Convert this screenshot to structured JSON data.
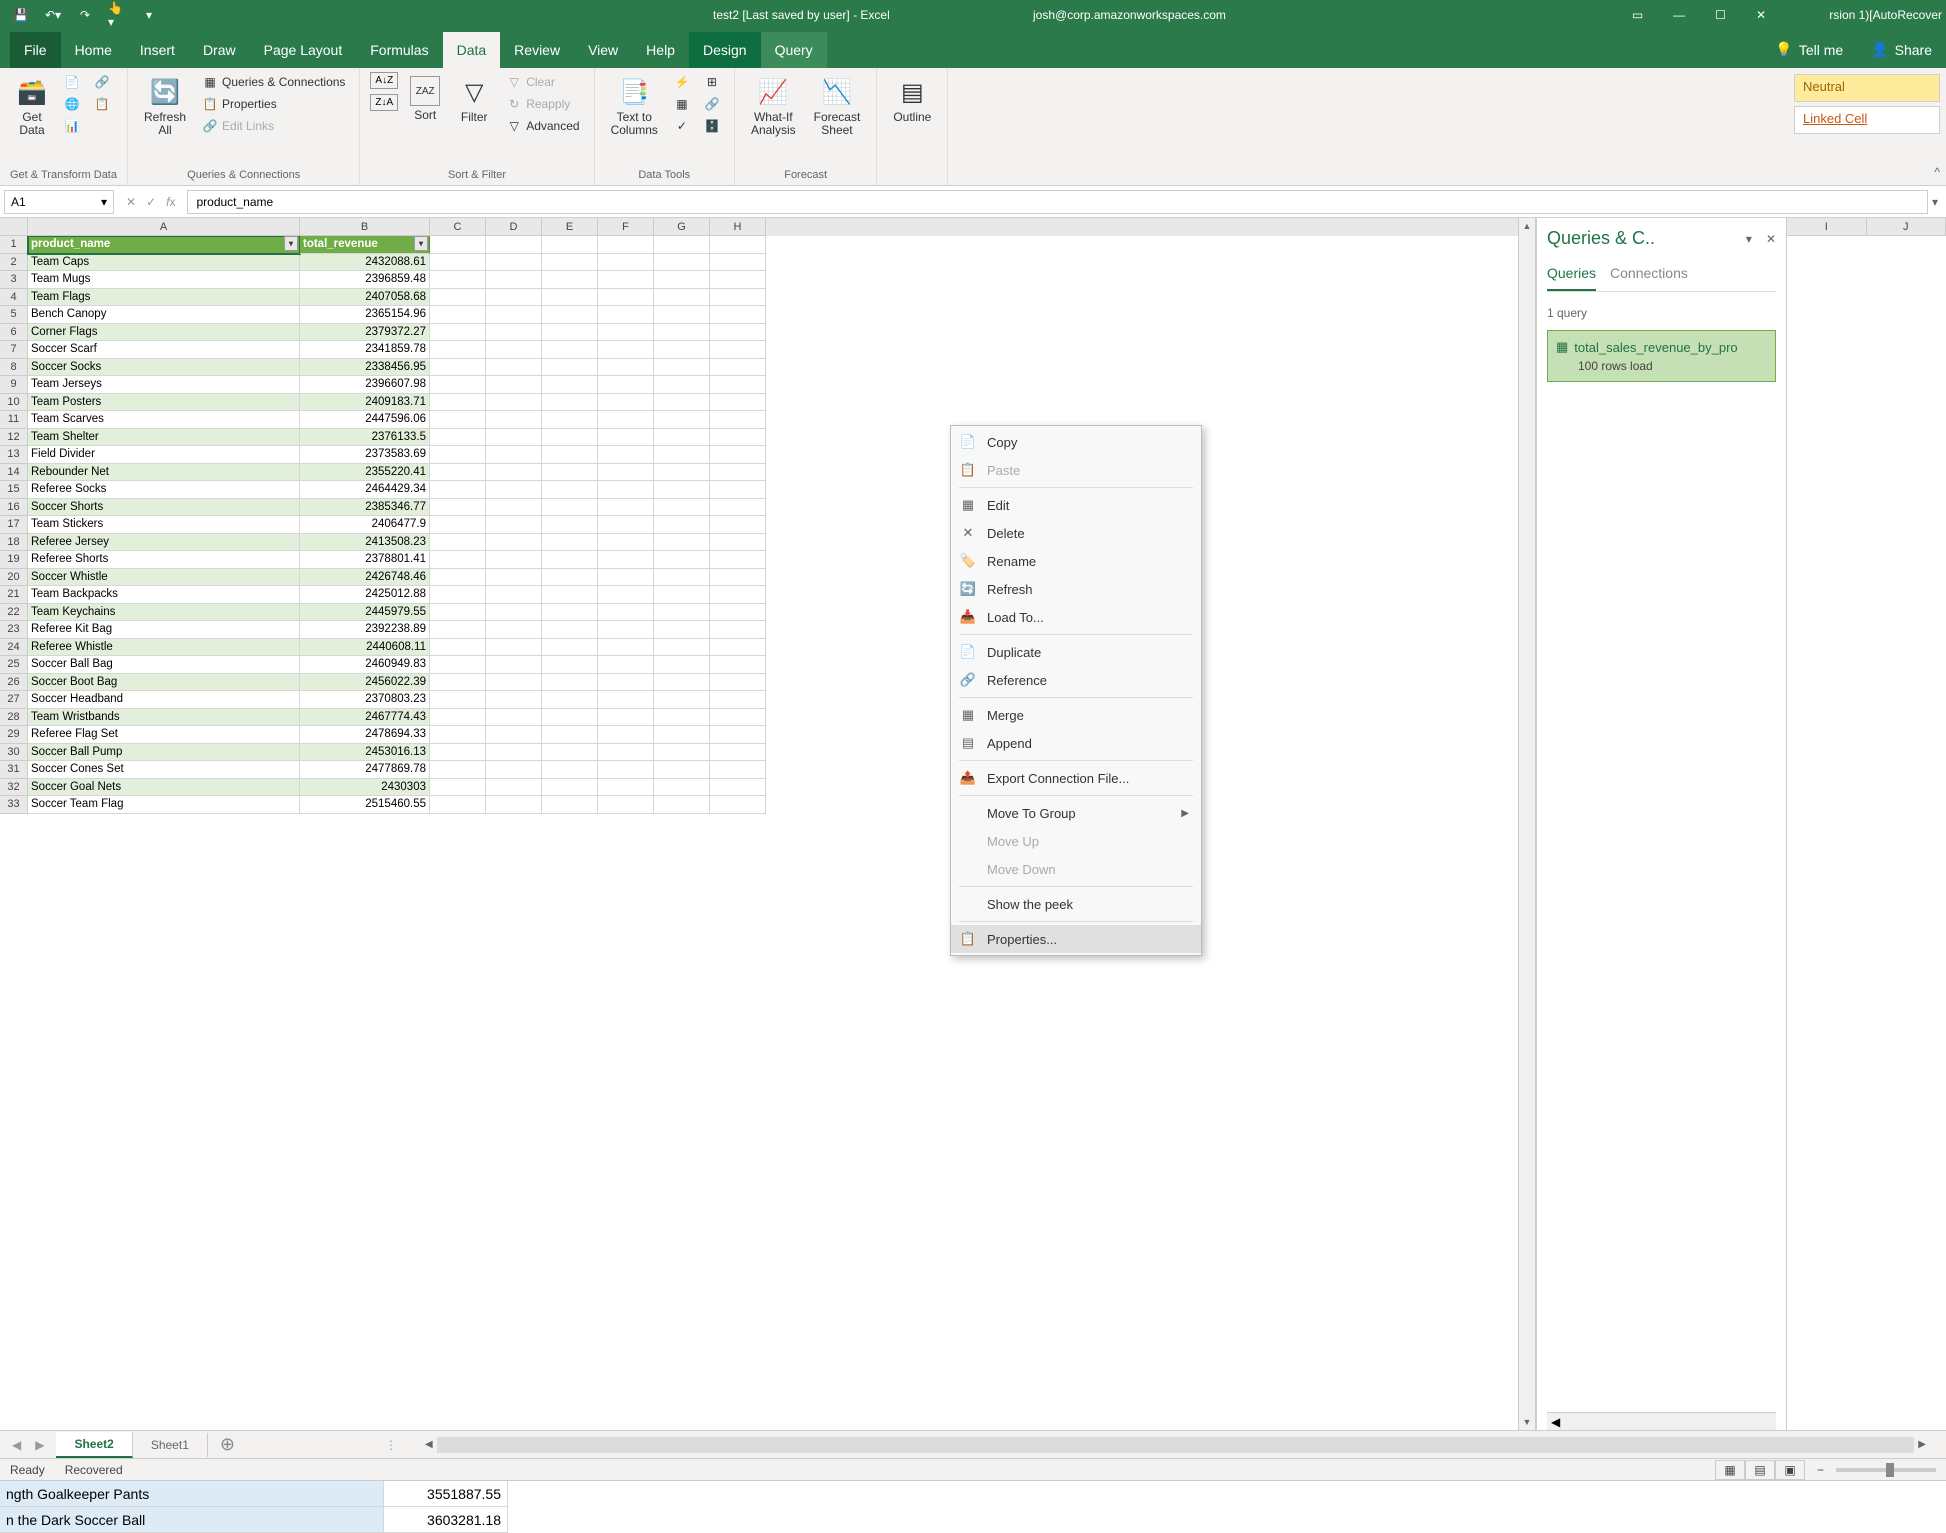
{
  "title_bar": {
    "title": "test2 [Last saved by user] - Excel",
    "user": "josh@corp.amazonworkspaces.com",
    "extra_right": "rsion 1)[AutoRecover"
  },
  "ribbon_tabs": [
    "File",
    "Home",
    "Insert",
    "Draw",
    "Page Layout",
    "Formulas",
    "Data",
    "Review",
    "View",
    "Help",
    "Design",
    "Query"
  ],
  "tellme": "Tell me",
  "share": "Share",
  "ribbon": {
    "get_data": "Get\nData",
    "group1": "Get & Transform Data",
    "refresh_all": "Refresh\nAll",
    "queries_conn": "Queries & Connections",
    "properties": "Properties",
    "edit_links": "Edit Links",
    "group2": "Queries & Connections",
    "sort": "Sort",
    "filter": "Filter",
    "clear": "Clear",
    "reapply": "Reapply",
    "advanced": "Advanced",
    "group3": "Sort & Filter",
    "text_to_columns": "Text to\nColumns",
    "group4": "Data Tools",
    "whatif": "What-If\nAnalysis",
    "forecast_sheet": "Forecast\nSheet",
    "group5": "Forecast",
    "outline": "Outline",
    "neutral": "Neutral",
    "linked_cell": "Linked Cell"
  },
  "formula": {
    "name_box": "A1",
    "fx_value": "product_name"
  },
  "columns": [
    "A",
    "B",
    "C",
    "D",
    "E",
    "F",
    "G",
    "H"
  ],
  "right_columns": [
    "I",
    "J"
  ],
  "table": {
    "headers": [
      "product_name",
      "total_revenue"
    ],
    "rows": [
      [
        "Team Caps",
        "2432088.61"
      ],
      [
        "Team Mugs",
        "2396859.48"
      ],
      [
        "Team Flags",
        "2407058.68"
      ],
      [
        "Bench Canopy",
        "2365154.96"
      ],
      [
        "Corner Flags",
        "2379372.27"
      ],
      [
        "Soccer Scarf",
        "2341859.78"
      ],
      [
        "Soccer Socks",
        "2338456.95"
      ],
      [
        "Team Jerseys",
        "2396607.98"
      ],
      [
        "Team Posters",
        "2409183.71"
      ],
      [
        "Team Scarves",
        "2447596.06"
      ],
      [
        "Team Shelter",
        "2376133.5"
      ],
      [
        "Field Divider",
        "2373583.69"
      ],
      [
        "Rebounder Net",
        "2355220.41"
      ],
      [
        "Referee Socks",
        "2464429.34"
      ],
      [
        "Soccer Shorts",
        "2385346.77"
      ],
      [
        "Team Stickers",
        "2406477.9"
      ],
      [
        "Referee Jersey",
        "2413508.23"
      ],
      [
        "Referee Shorts",
        "2378801.41"
      ],
      [
        "Soccer Whistle",
        "2426748.46"
      ],
      [
        "Team Backpacks",
        "2425012.88"
      ],
      [
        "Team Keychains",
        "2445979.55"
      ],
      [
        "Referee Kit Bag",
        "2392238.89"
      ],
      [
        "Referee Whistle",
        "2440608.11"
      ],
      [
        "Soccer Ball Bag",
        "2460949.83"
      ],
      [
        "Soccer Boot Bag",
        "2456022.39"
      ],
      [
        "Soccer Headband",
        "2370803.23"
      ],
      [
        "Team Wristbands",
        "2467774.43"
      ],
      [
        "Referee Flag Set",
        "2478694.33"
      ],
      [
        "Soccer Ball Pump",
        "2453016.13"
      ],
      [
        "Soccer Cones Set",
        "2477869.78"
      ],
      [
        "Soccer Goal Nets",
        "2430303"
      ],
      [
        "Soccer Team Flag",
        "2515460.55"
      ]
    ]
  },
  "queries_pane": {
    "title": "Queries & C..",
    "tab_queries": "Queries",
    "tab_connections": "Connections",
    "count": "1 query",
    "query_name": "total_sales_revenue_by_pro",
    "query_status": "100 rows load"
  },
  "context_menu": {
    "copy": "Copy",
    "paste": "Paste",
    "edit": "Edit",
    "delete": "Delete",
    "rename": "Rename",
    "refresh": "Refresh",
    "load_to": "Load To...",
    "duplicate": "Duplicate",
    "reference": "Reference",
    "merge": "Merge",
    "append": "Append",
    "export": "Export Connection File...",
    "move_group": "Move To Group",
    "move_up": "Move Up",
    "move_down": "Move Down",
    "show_peek": "Show the peek",
    "properties": "Properties..."
  },
  "sheet_tabs": {
    "sheet2": "Sheet2",
    "sheet1": "Sheet1"
  },
  "status": {
    "ready": "Ready",
    "recovered": "Recovered"
  },
  "bottom_frag": {
    "row1_name": "ngth Goalkeeper Pants",
    "row1_val": "3551887.55",
    "row2_name": "n the Dark Soccer Ball",
    "row2_val": "3603281.18"
  }
}
